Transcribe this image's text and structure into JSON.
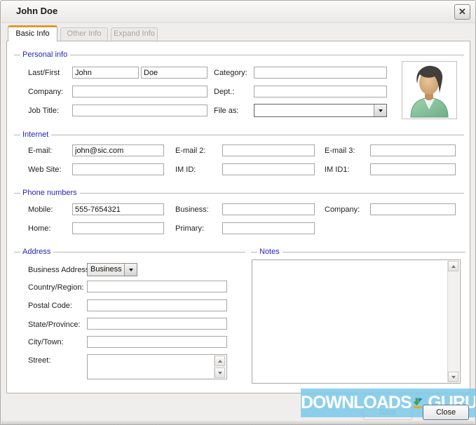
{
  "window": {
    "title": "John Doe",
    "close_glyph": "✕"
  },
  "tabs": [
    {
      "label": "Basic Info"
    },
    {
      "label": "Other Info"
    },
    {
      "label": "Expand Info"
    }
  ],
  "personal": {
    "title": "Personal info",
    "last_first_label": "Last/First",
    "last_value": "John",
    "first_value": "Doe",
    "category_label": "Category:",
    "category_value": "",
    "company_label": "Company:",
    "company_value": "",
    "dept_label": "Dept.:",
    "dept_value": "",
    "job_title_label": "Job Title:",
    "job_title_value": "",
    "file_as_label": "File as:",
    "file_as_value": ""
  },
  "internet": {
    "title": "Internet",
    "email_label": "E-mail:",
    "email_value": "john@sic.com",
    "email2_label": "E-mail 2:",
    "email2_value": "",
    "email3_label": "E-mail 3:",
    "email3_value": "",
    "website_label": "Web Site:",
    "website_value": "",
    "im_id_label": "IM ID:",
    "im_id_value": "",
    "im_id1_label": "IM ID1:",
    "im_id1_value": ""
  },
  "phone": {
    "title": "Phone numbers",
    "mobile_label": "Mobile:",
    "mobile_value": "555-7654321",
    "business_label": "Business:",
    "business_value": "",
    "company_label": "Company:",
    "company_value": "",
    "home_label": "Home:",
    "home_value": "",
    "primary_label": "Primary:",
    "primary_value": ""
  },
  "address": {
    "title": "Address",
    "type_label": "Business Address",
    "type_value": "Business",
    "country_label": "Country/Region:",
    "country_value": "",
    "postal_label": "Postal Code:",
    "postal_value": "",
    "state_label": "State/Province:",
    "state_value": "",
    "city_label": "City/Town:",
    "city_value": "",
    "street_label": "Street:",
    "street_value": ""
  },
  "notes": {
    "title": "Notes",
    "value": ""
  },
  "footer": {
    "save_label": "Save",
    "close_label": "Close"
  },
  "watermark": {
    "brand_left": "DOWNLOADS",
    "brand_right": ".GURU"
  },
  "colors": {
    "tab_accent": "#e29a2e",
    "section_title": "#2424bd",
    "watermark_band": "#7bc9e9"
  }
}
